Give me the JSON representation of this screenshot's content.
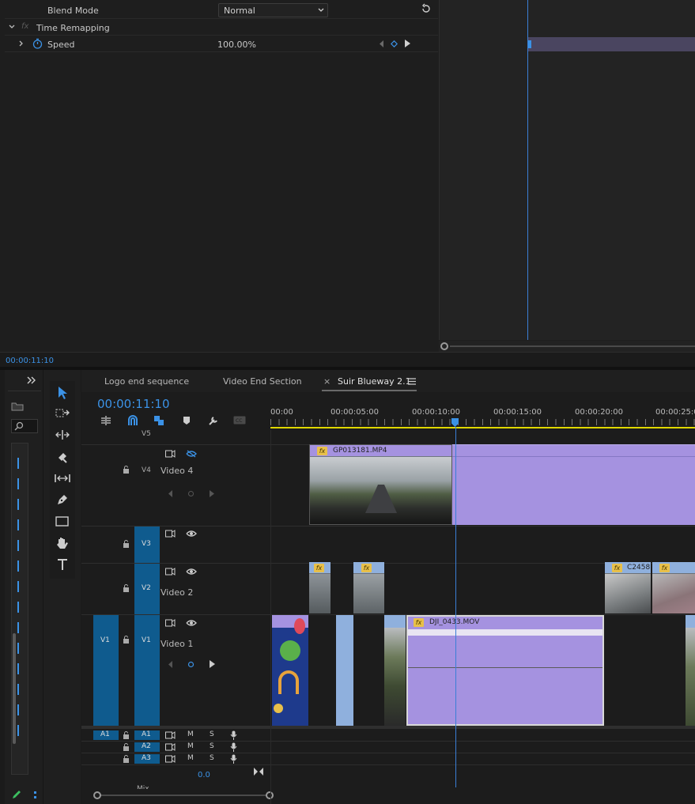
{
  "effect_controls": {
    "blend_mode_label": "Blend Mode",
    "blend_mode_value": "Normal",
    "time_remapping_label": "Time Remapping",
    "speed_label": "Speed",
    "speed_value": "100.00%",
    "current_time": "00:00:11:10"
  },
  "timeline": {
    "tabs": [
      {
        "label": "Logo end sequence"
      },
      {
        "label": "Video End Section"
      },
      {
        "label": "Suir Blueway 2.1",
        "active": true
      }
    ],
    "tab_close": "×",
    "timecode": "00:00:11:10",
    "ruler": [
      "00:00",
      "00:00:05:00",
      "00:00:10:00",
      "00:00:15:00",
      "00:00:20:00",
      "00:00:25:0"
    ],
    "video_tracks": [
      {
        "id": "V5",
        "name": ""
      },
      {
        "id": "V4",
        "name": "Video 4"
      },
      {
        "id": "V3",
        "name": ""
      },
      {
        "id": "V2",
        "name": "Video 2"
      },
      {
        "id": "V1",
        "name": "Video 1",
        "source": "V1"
      }
    ],
    "audio_tracks": [
      {
        "id": "A1",
        "source": "A1"
      },
      {
        "id": "A2"
      },
      {
        "id": "A3"
      }
    ],
    "mute": "M",
    "solo": "S",
    "mix_label": "Mix",
    "mix_value": "0.0",
    "clips": {
      "v4": "GP013181.MP4",
      "v2": "C2458.",
      "v1": "DJI_0433.MOV"
    },
    "fx": "fx"
  },
  "colors": {
    "accent": "#2d8ceb",
    "clip_purple": "#a592e0",
    "track_target": "#0f5b8e",
    "work_area": "#e0d800"
  }
}
